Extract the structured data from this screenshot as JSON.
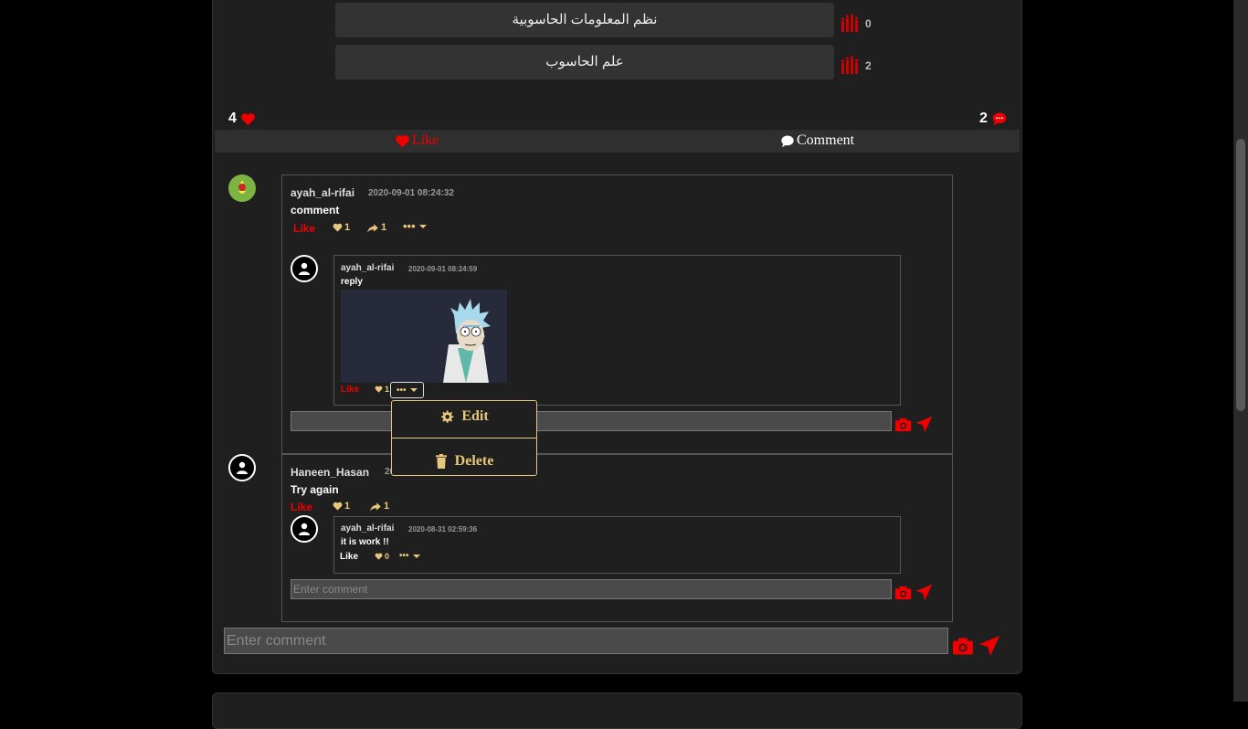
{
  "poll": {
    "options": [
      {
        "label": "نظم المعلومات الحاسوبية",
        "count": "0"
      },
      {
        "label": "علم الحاسوب",
        "count": "2"
      }
    ]
  },
  "post_stats": {
    "likes": "4",
    "comments": "2"
  },
  "actions": {
    "like_label": "Like",
    "comment_label": "Comment"
  },
  "comments": [
    {
      "username": "ayah_al-rifai",
      "timestamp": "2020-09-01 08:24:32",
      "text": "comment",
      "like_label": "Like",
      "likes": "1",
      "shares": "1",
      "reply": {
        "username": "ayah_al-rifai",
        "timestamp": "2020-09-01 08:24:59",
        "text": "reply",
        "like_label": "Like",
        "likes": "1"
      },
      "input_placeholder": ""
    },
    {
      "username": "Haneen_Hasan",
      "timestamp": "20",
      "text": "Try again",
      "like_label": "Like",
      "likes": "1",
      "shares": "1",
      "reply": {
        "username": "ayah_al-rifai",
        "timestamp": "2020-08-31 02:59:36",
        "text": "it is work !!",
        "like_label": "Like",
        "likes": "0"
      },
      "input_placeholder": "Enter comment"
    }
  ],
  "dropdown": {
    "edit_label": "Edit",
    "delete_label": "Delete"
  },
  "main_input_placeholder": "Enter comment",
  "colors": {
    "accent_red": "#e00000",
    "accent_gold": "#e9c77a",
    "bg": "#000000",
    "card": "#1f1f1f"
  }
}
